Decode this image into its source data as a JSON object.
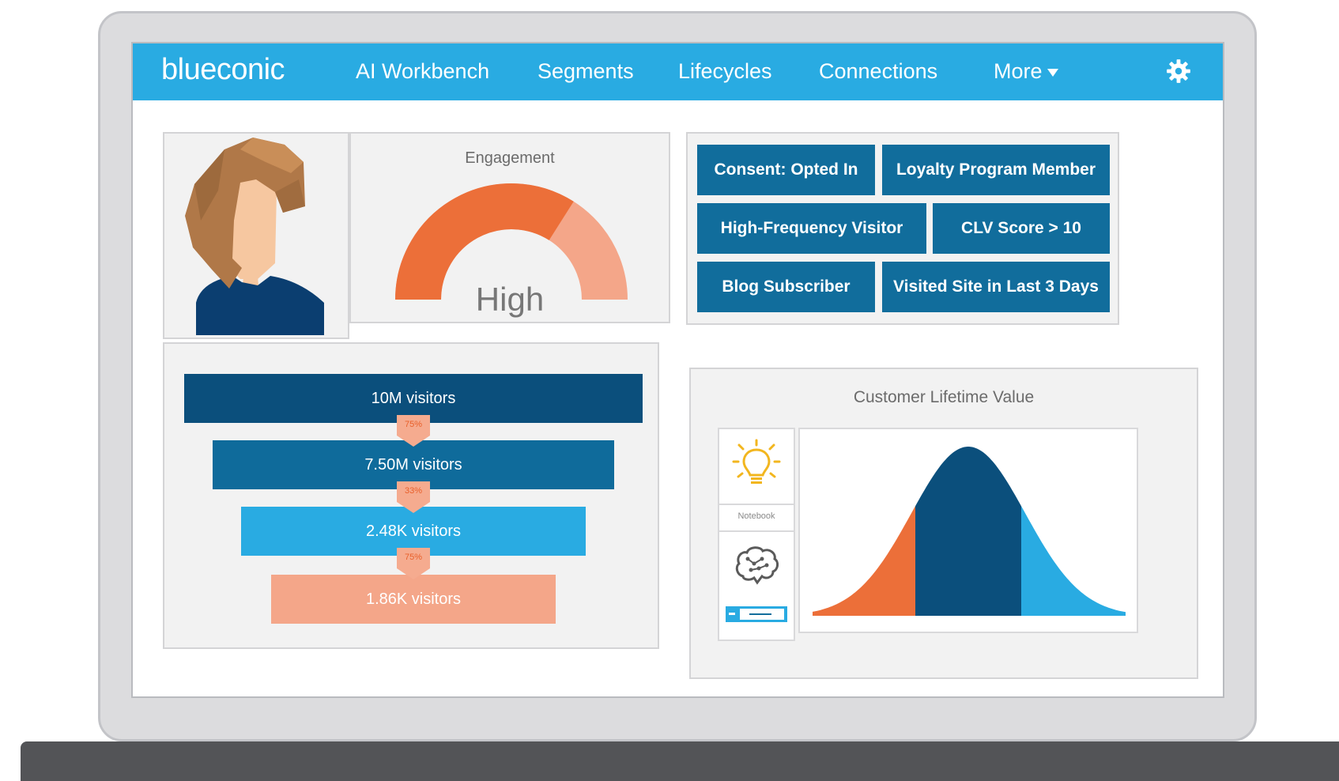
{
  "nav": {
    "logo": "blueconic",
    "items": [
      "AI Workbench",
      "Segments",
      "Lifecycles",
      "Connections",
      "More"
    ],
    "settings_icon": "gear-icon"
  },
  "engagement": {
    "title": "Engagement",
    "level": "High",
    "fill_fraction": 0.68,
    "colors": {
      "primary": "#ec6f39",
      "secondary": "#f4a689"
    }
  },
  "tags": [
    "Consent: Opted In",
    "Loyalty Program Member",
    "High-Frequency Visitor",
    "CLV Score > 10",
    "Blog Subscriber",
    "Visited Site in Last 3 Days"
  ],
  "funnel": {
    "stages": [
      {
        "label": "10M visitors",
        "color": "#0b4f7c"
      },
      {
        "label": "7.50M visitors",
        "color": "#0f6b9b"
      },
      {
        "label": "2.48K visitors",
        "color": "#29abe2"
      },
      {
        "label": "1.86K visitors",
        "color": "#f4a689"
      }
    ],
    "conversions": [
      "75%",
      "33%",
      "75%"
    ]
  },
  "clv": {
    "title": "Customer Lifetime Value",
    "notebook_label": "Notebook",
    "icons": [
      "lightbulb-icon",
      "brain-icon"
    ],
    "segment_colors": [
      "#ec6f39",
      "#0b4f7c",
      "#29abe2"
    ]
  }
}
